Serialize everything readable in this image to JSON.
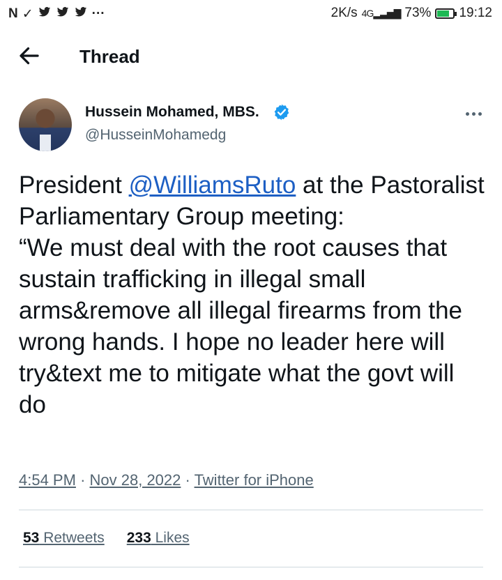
{
  "status_bar": {
    "left_icons": [
      "N",
      "✓",
      "🐦",
      "🐦",
      "🐦",
      "···"
    ],
    "network_speed": "2K/s",
    "network_type": "4G",
    "battery": "73%",
    "time": "19:12"
  },
  "header": {
    "title": "Thread"
  },
  "tweet": {
    "author_name": "Hussein Mohamed, MBS.",
    "author_handle": "@HusseinMohamedg",
    "text_prefix": "President ",
    "mention": "@WilliamsRuto",
    "text_rest": " at the Pastoralist Parliamentary Group meeting:\n“We must deal with the root causes that sustain trafficking in illegal small arms&remove all illegal firearms from the wrong hands. I hope no leader here will try&text me to mitigate what the govt will do",
    "time": "4:54 PM",
    "date": "Nov 28, 2022",
    "source": "Twitter for iPhone",
    "retweets_count": "53",
    "retweets_label": " Retweets",
    "likes_count": "233",
    "likes_label": " Likes"
  },
  "colors": {
    "link": "#1d5fc4",
    "verified": "#1d9bf0",
    "secondary_text": "#536471"
  }
}
